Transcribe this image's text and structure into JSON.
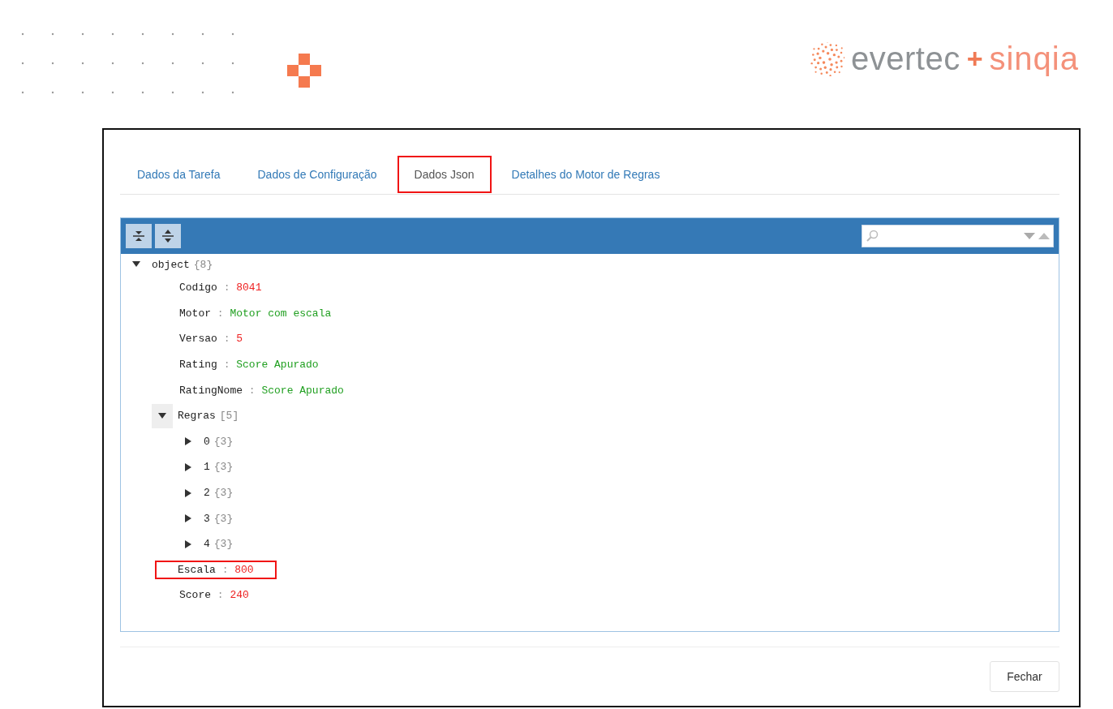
{
  "logo": {
    "brand": "evertec",
    "plus": "+",
    "partner": "sinqia"
  },
  "tabs": [
    {
      "label": "Dados da Tarefa",
      "selected": false,
      "highlighted": false
    },
    {
      "label": "Dados de Configuração",
      "selected": false,
      "highlighted": false
    },
    {
      "label": "Dados Json",
      "selected": true,
      "highlighted": true
    },
    {
      "label": "Detalhes do Motor de Regras",
      "selected": false,
      "highlighted": false
    }
  ],
  "json_viewer": {
    "tree": {
      "key": "object",
      "count": "{8}",
      "expanded": true,
      "children": [
        {
          "key": "Codigo",
          "sep": ":",
          "value": "8041",
          "kind": "number",
          "highlighted": false
        },
        {
          "key": "Motor",
          "sep": ":",
          "value": "Motor com escala",
          "kind": "string",
          "highlighted": false
        },
        {
          "key": "Versao",
          "sep": ":",
          "value": "5",
          "kind": "number",
          "highlighted": false
        },
        {
          "key": "Rating",
          "sep": ":",
          "value": "Score Apurado",
          "kind": "string",
          "highlighted": false
        },
        {
          "key": "RatingNome",
          "sep": ":",
          "value": "Score Apurado",
          "kind": "string",
          "highlighted": false
        },
        {
          "key": "Regras",
          "count": "[5]",
          "expanded": true,
          "hovered": true,
          "children": [
            {
              "key": "0",
              "count": "{3}",
              "expanded": false
            },
            {
              "key": "1",
              "count": "{3}",
              "expanded": false
            },
            {
              "key": "2",
              "count": "{3}",
              "expanded": false
            },
            {
              "key": "3",
              "count": "{3}",
              "expanded": false
            },
            {
              "key": "4",
              "count": "{3}",
              "expanded": false
            }
          ]
        },
        {
          "key": "Escala",
          "sep": ":",
          "value": "800",
          "kind": "number",
          "highlighted": true
        },
        {
          "key": "Score",
          "sep": ":",
          "value": "240",
          "kind": "number",
          "highlighted": false
        }
      ]
    }
  },
  "buttons": [
    "Fechar"
  ]
}
